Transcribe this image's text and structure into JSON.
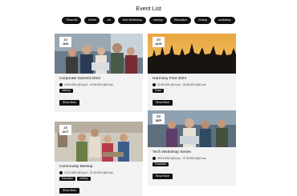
{
  "page": {
    "title": "Event List"
  },
  "filters": [
    "Show All",
    "Event",
    "Art",
    "Tech Workshop",
    "meetup",
    "Education",
    "Charity",
    "workshop"
  ],
  "events": [
    {
      "day": "10",
      "month": "JUN",
      "title": "Corporate Summit 2024",
      "time": "10.06.2024 @12 pm - 10.06.2024 @12 am",
      "tags": [
        "meetup"
      ],
      "button": "Show More"
    },
    {
      "day": "20",
      "month": "AUG",
      "title": "Harmony Fest 2024",
      "time": "20.08.2024 @12 pm - 23.08.2024 @12 am",
      "tags": [
        "Event"
      ],
      "button": "Show More"
    },
    {
      "day": "09",
      "month": "SEP",
      "title": "Tech Workshop Series",
      "time": "09.09.2024 @12 pm - 07.09.2024 @12 am",
      "tags": [
        "Education"
      ],
      "button": "Show More"
    },
    {
      "day": "15",
      "month": "OCT",
      "title": "Community Meetup",
      "time": "15.10.2024 @12 pm - 22.10.2024 @12 am",
      "tags": [
        "Education",
        "meetup"
      ],
      "button": "Show More"
    }
  ],
  "colors": {
    "button_bg": "#111111",
    "card_bg": "#f2f2f2",
    "page_bg": "#ffffff"
  }
}
